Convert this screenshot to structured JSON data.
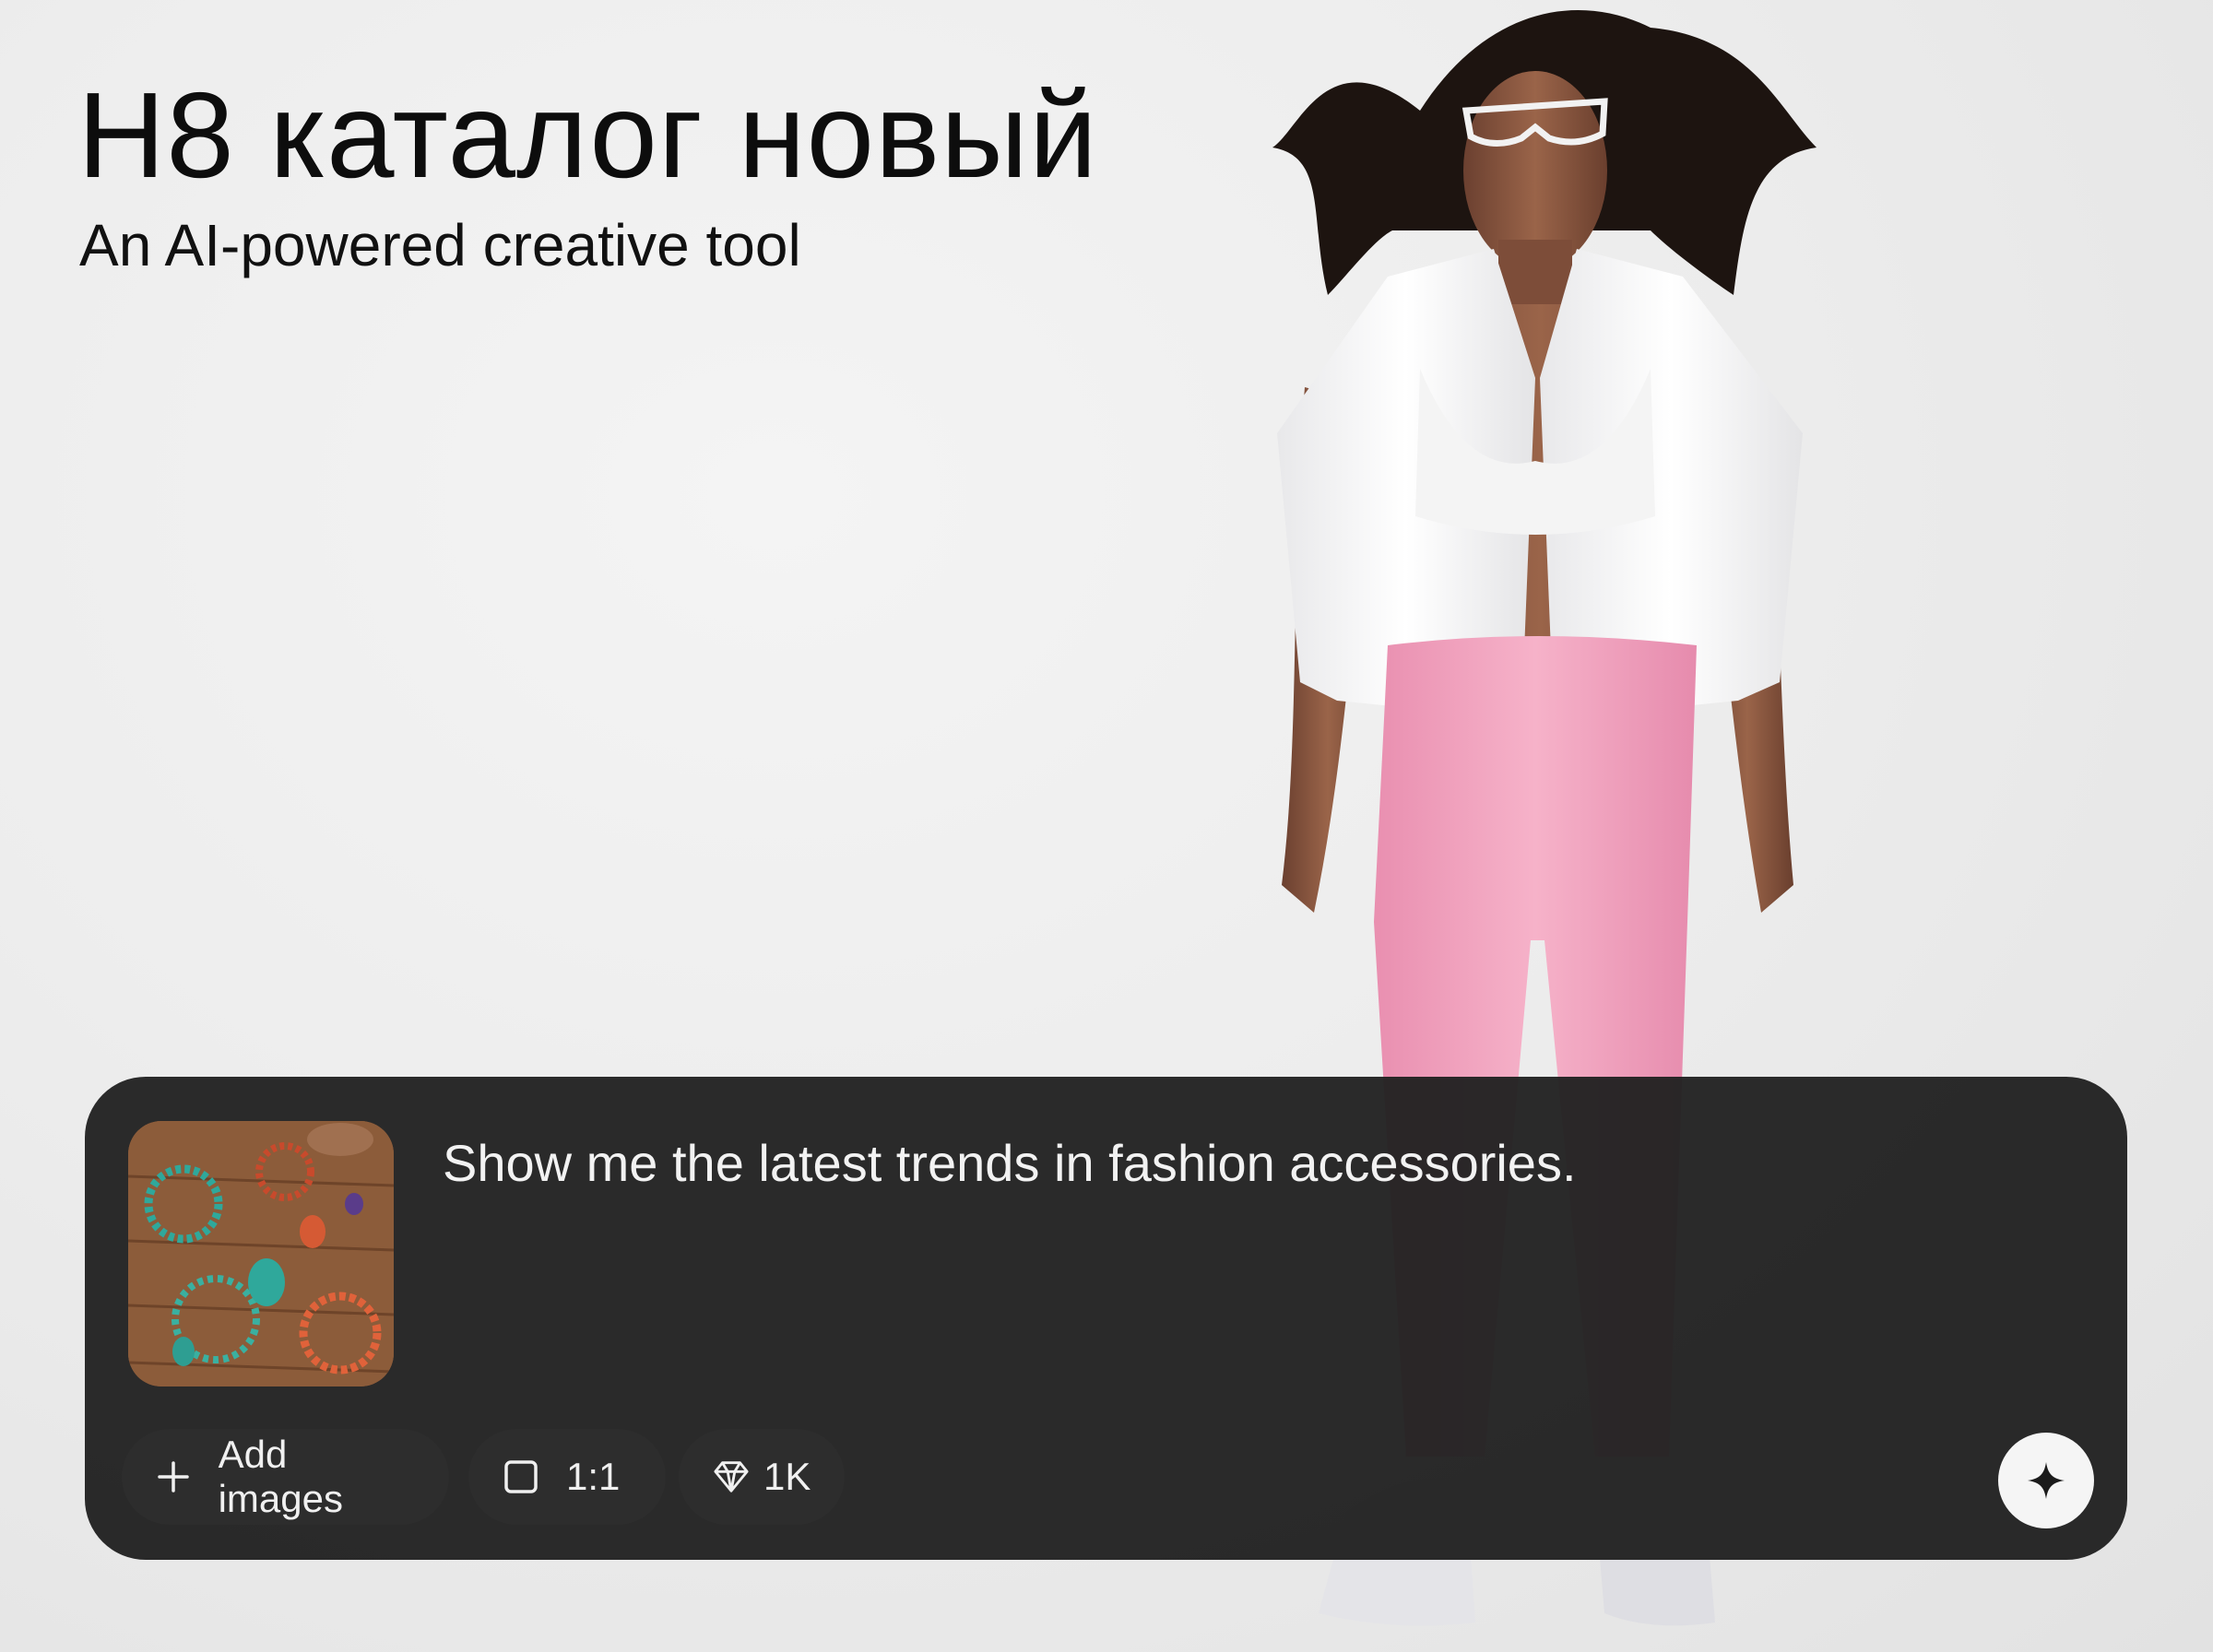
{
  "header": {
    "title": "H8 каталог новый",
    "subtitle": "An AI-powered creative tool"
  },
  "prompt_panel": {
    "reference_image_alt": "jewelry-collection-thumbnail",
    "prompt_text": "Show me the latest trends in fashion accessories.",
    "add_images_label": "Add images",
    "aspect_ratio_label": "1:1",
    "quality_label": "1K",
    "icons": {
      "add": "plus-icon",
      "ratio": "square-icon",
      "quality": "diamond-icon",
      "generate": "sparkle-icon"
    }
  },
  "colors": {
    "panel_background": "#212121",
    "chip_background": "#2d2d2d",
    "generate_button": "#f5f5f5",
    "leggings": "#f2a2be",
    "jacket": "#f7f7f7"
  }
}
